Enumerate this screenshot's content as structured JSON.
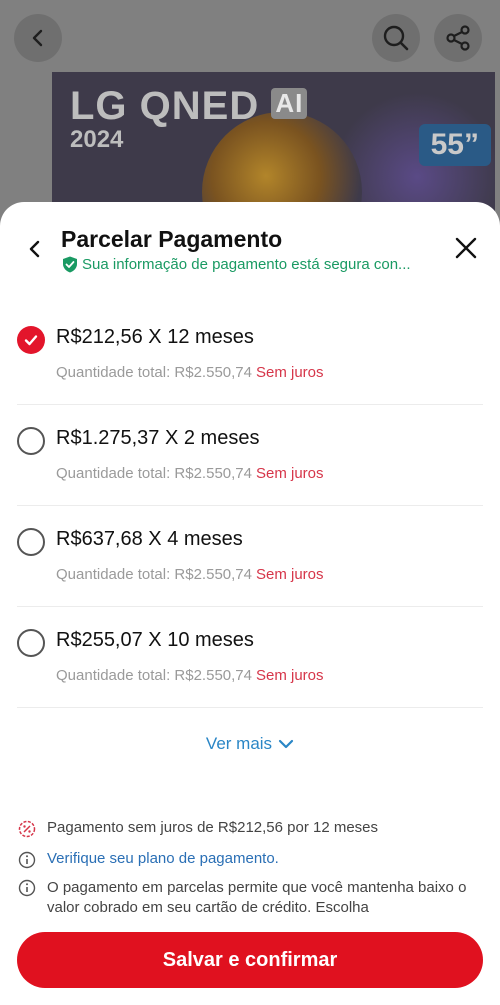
{
  "background": {
    "brand_text": "LG QNED",
    "brand_badge": "AI",
    "year": "2024",
    "size": "55”"
  },
  "sheet": {
    "title": "Parcelar Pagamento",
    "secure_text": "Sua informação de pagamento está segura con..."
  },
  "options": [
    {
      "main": "R$212,56 X 12 meses",
      "total": "Quantidade total: R$2.550,74",
      "tag": "Sem juros",
      "selected": true
    },
    {
      "main": "R$1.275,37 X 2 meses",
      "total": "Quantidade total: R$2.550,74",
      "tag": "Sem juros",
      "selected": false
    },
    {
      "main": "R$637,68 X 4 meses",
      "total": "Quantidade total: R$2.550,74",
      "tag": "Sem juros",
      "selected": false
    },
    {
      "main": "R$255,07 X 10 meses",
      "total": "Quantidade total: R$2.550,74",
      "tag": "Sem juros",
      "selected": false
    }
  ],
  "see_more": "Ver mais",
  "info": {
    "no_interest": "Pagamento sem juros de R$212,56 por 12 meses",
    "verify_link": "Verifique seu plano de pagamento.",
    "explanation": "O pagamento em parcelas permite que você mantenha baixo o valor cobrado em seu cartão de crédito. Escolha"
  },
  "cta": "Salvar e confirmar",
  "colors": {
    "accent": "#e0111f",
    "secure_green": "#1a9a63",
    "link_blue": "#2a86c6"
  }
}
